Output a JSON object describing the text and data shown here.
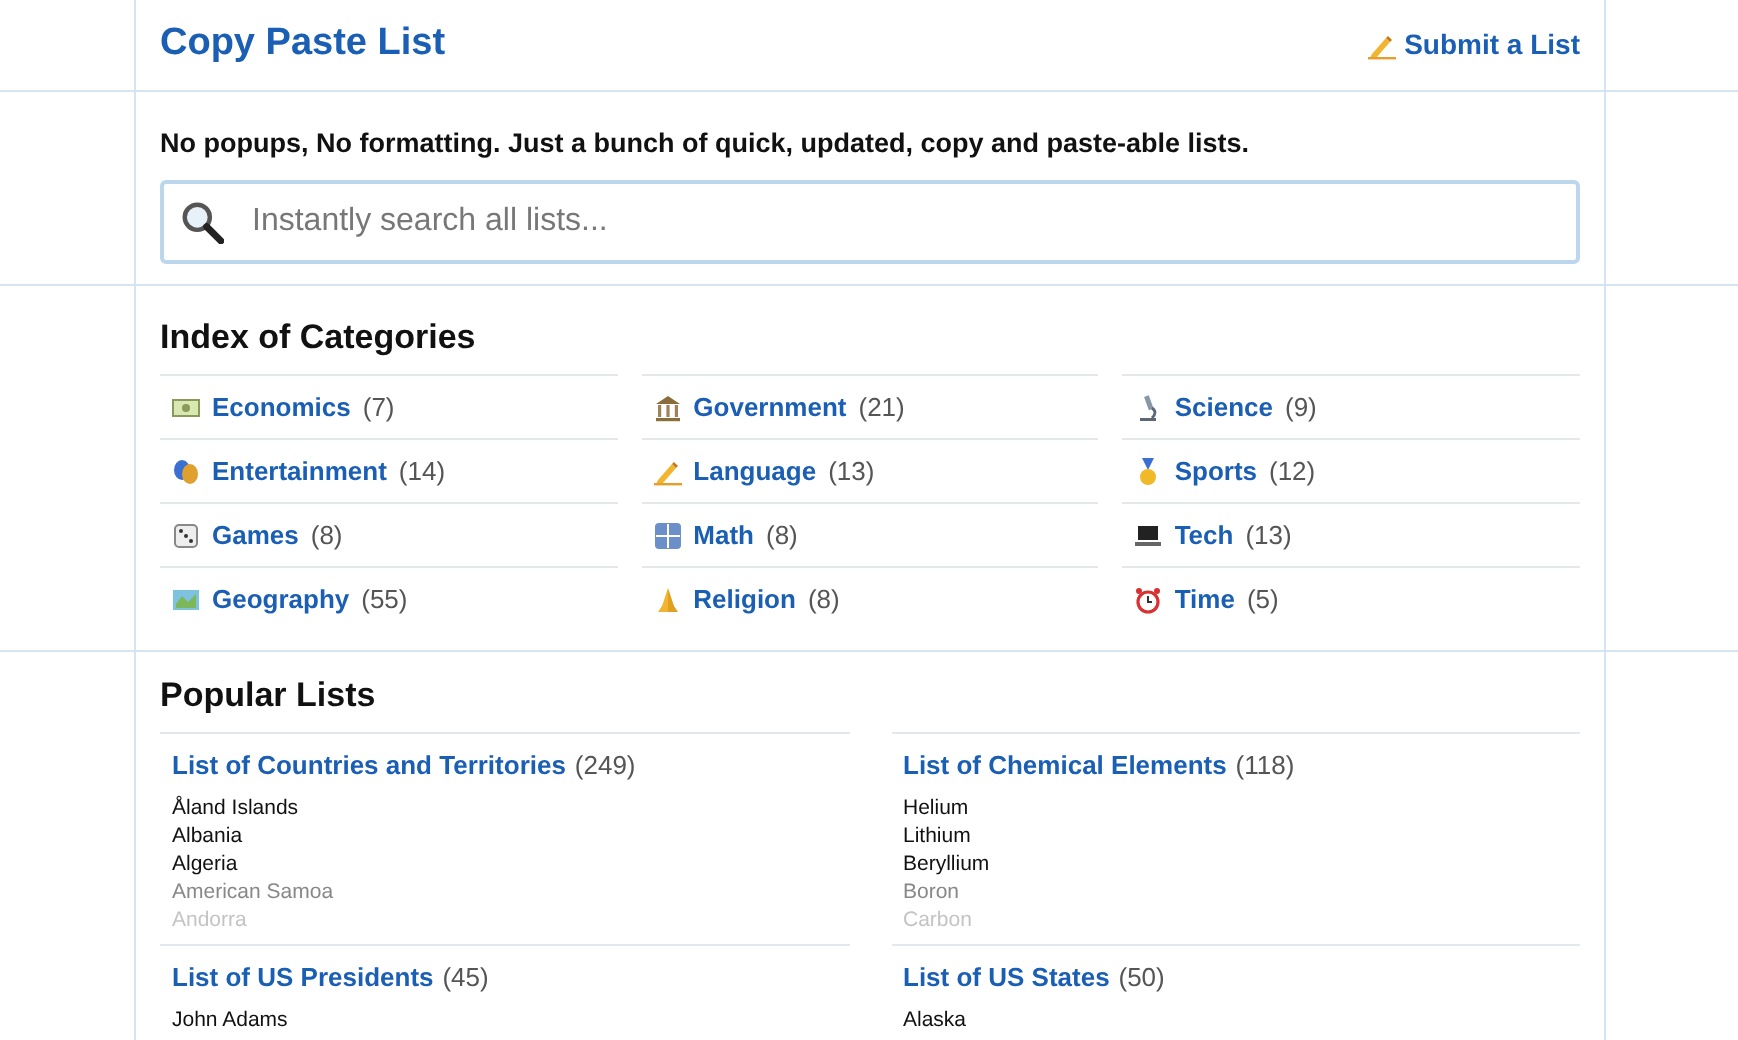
{
  "header": {
    "title": "Copy Paste List",
    "submit_link": "Submit a List"
  },
  "tagline": "No popups, No formatting. Just a bunch of quick, updated, copy and paste-able lists.",
  "search": {
    "placeholder": "Instantly search all lists..."
  },
  "categories": {
    "heading": "Index of Categories",
    "items": [
      {
        "label": "Economics",
        "count": "(7)"
      },
      {
        "label": "Government",
        "count": "(21)"
      },
      {
        "label": "Science",
        "count": "(9)"
      },
      {
        "label": "Entertainment",
        "count": "(14)"
      },
      {
        "label": "Language",
        "count": "(13)"
      },
      {
        "label": "Sports",
        "count": "(12)"
      },
      {
        "label": "Games",
        "count": "(8)"
      },
      {
        "label": "Math",
        "count": "(8)"
      },
      {
        "label": "Tech",
        "count": "(13)"
      },
      {
        "label": "Geography",
        "count": "(55)"
      },
      {
        "label": "Religion",
        "count": "(8)"
      },
      {
        "label": "Time",
        "count": "(5)"
      }
    ]
  },
  "popular": {
    "heading": "Popular Lists",
    "lists": [
      {
        "title": "List of Countries and Territories",
        "count": "(249)",
        "items": [
          {
            "text": "Åland Islands",
            "kind": "normal"
          },
          {
            "text": "Albania",
            "kind": "normal"
          },
          {
            "text": "Algeria",
            "kind": "normal"
          },
          {
            "text": "American Samoa",
            "kind": "dim"
          },
          {
            "text": "Andorra",
            "kind": "faint"
          }
        ]
      },
      {
        "title": "List of Chemical Elements",
        "count": "(118)",
        "items": [
          {
            "text": "Helium",
            "kind": "normal"
          },
          {
            "text": "Lithium",
            "kind": "normal"
          },
          {
            "text": "Beryllium",
            "kind": "normal"
          },
          {
            "text": "Boron",
            "kind": "dim"
          },
          {
            "text": "Carbon",
            "kind": "faint"
          }
        ]
      },
      {
        "title": "List of US Presidents",
        "count": "(45)",
        "items": [
          {
            "text": "John Adams",
            "kind": "normal"
          }
        ]
      },
      {
        "title": "List of US States",
        "count": "(50)",
        "items": [
          {
            "text": "Alaska",
            "kind": "normal"
          }
        ]
      }
    ]
  }
}
